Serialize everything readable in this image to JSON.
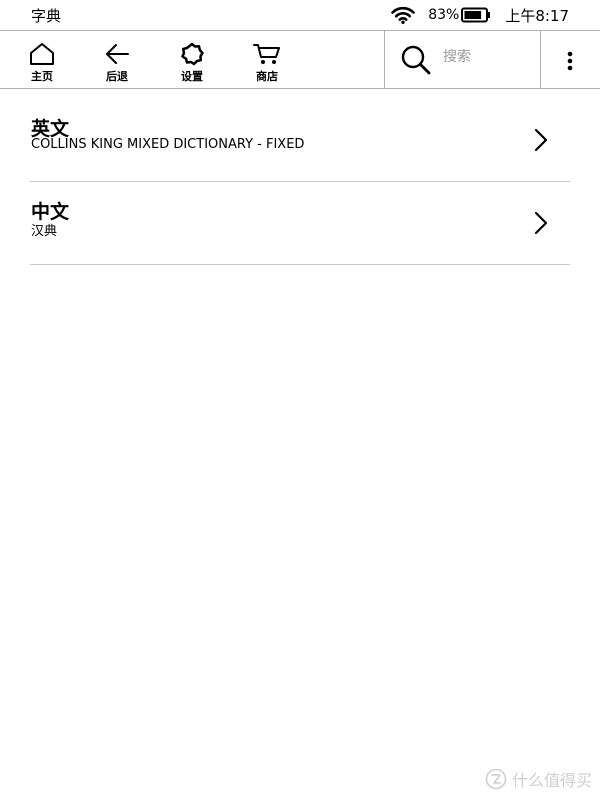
{
  "status_bar": {
    "title": "字典",
    "battery_percent": "83%",
    "battery_level": 0.83,
    "time": "上午8:17",
    "icons": [
      "wifi-icon",
      "battery-icon"
    ]
  },
  "toolbar": {
    "home_label": "主页",
    "back_label": "后退",
    "settings_label": "设置",
    "store_label": "商店",
    "icons": [
      "home-icon",
      "back-arrow-icon",
      "gear-icon",
      "cart-icon",
      "search-icon",
      "more-vertical-icon"
    ]
  },
  "search": {
    "placeholder": "搜索",
    "value": ""
  },
  "dictionaries": [
    {
      "title": "英文",
      "subtitle": "COLLINS KING MIXED DICTIONARY - FIXED"
    },
    {
      "title": "中文",
      "subtitle": "汉典"
    }
  ],
  "watermark": {
    "text": "什么值得买"
  },
  "colors": {
    "divider": "#c8c8c8",
    "placeholder": "#9a9a9a",
    "watermark": "#cfcfcf"
  }
}
